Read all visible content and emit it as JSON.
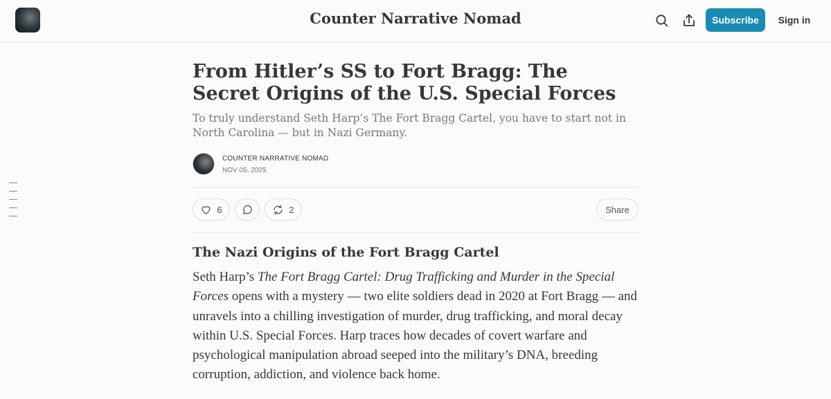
{
  "header": {
    "publication_name": "Counter Narrative Nomad",
    "subscribe_label": "Subscribe",
    "signin_label": "Sign in",
    "icons": [
      "search-icon",
      "share-icon"
    ]
  },
  "post": {
    "title": "From Hitler’s SS to Fort Bragg: The Secret Origins of the U.S. Special Forces",
    "subtitle": "To truly understand Seth Harp’s The Fort Bragg Cartel, you have to start not in North Carolina — but in Nazi Germany.",
    "author": "COUNTER NARRATIVE NOMAD",
    "date": "NOV 05, 2025",
    "likes": "6",
    "restacks": "2",
    "share_label": "Share",
    "section_heading": "The Nazi Origins of the Fort Bragg Cartel",
    "body_intro": "Seth Harp’s ",
    "body_book_title": "The Fort Bragg Cartel: Drug Trafficking and Murder in the Special Forces",
    "body_rest": " opens with a mystery — two elite soldiers dead in 2020 at Fort Bragg — and unravels into a chilling investigation of murder, drug trafficking, and moral decay within U.S. Special Forces. Harp traces how decades of covert warfare and psychological manipulation abroad seeped into the military’s DNA, breeding corruption, addiction, and violence back home."
  },
  "colors": {
    "accent": "#1a8bb3",
    "text": "#363737",
    "muted": "#777777"
  }
}
